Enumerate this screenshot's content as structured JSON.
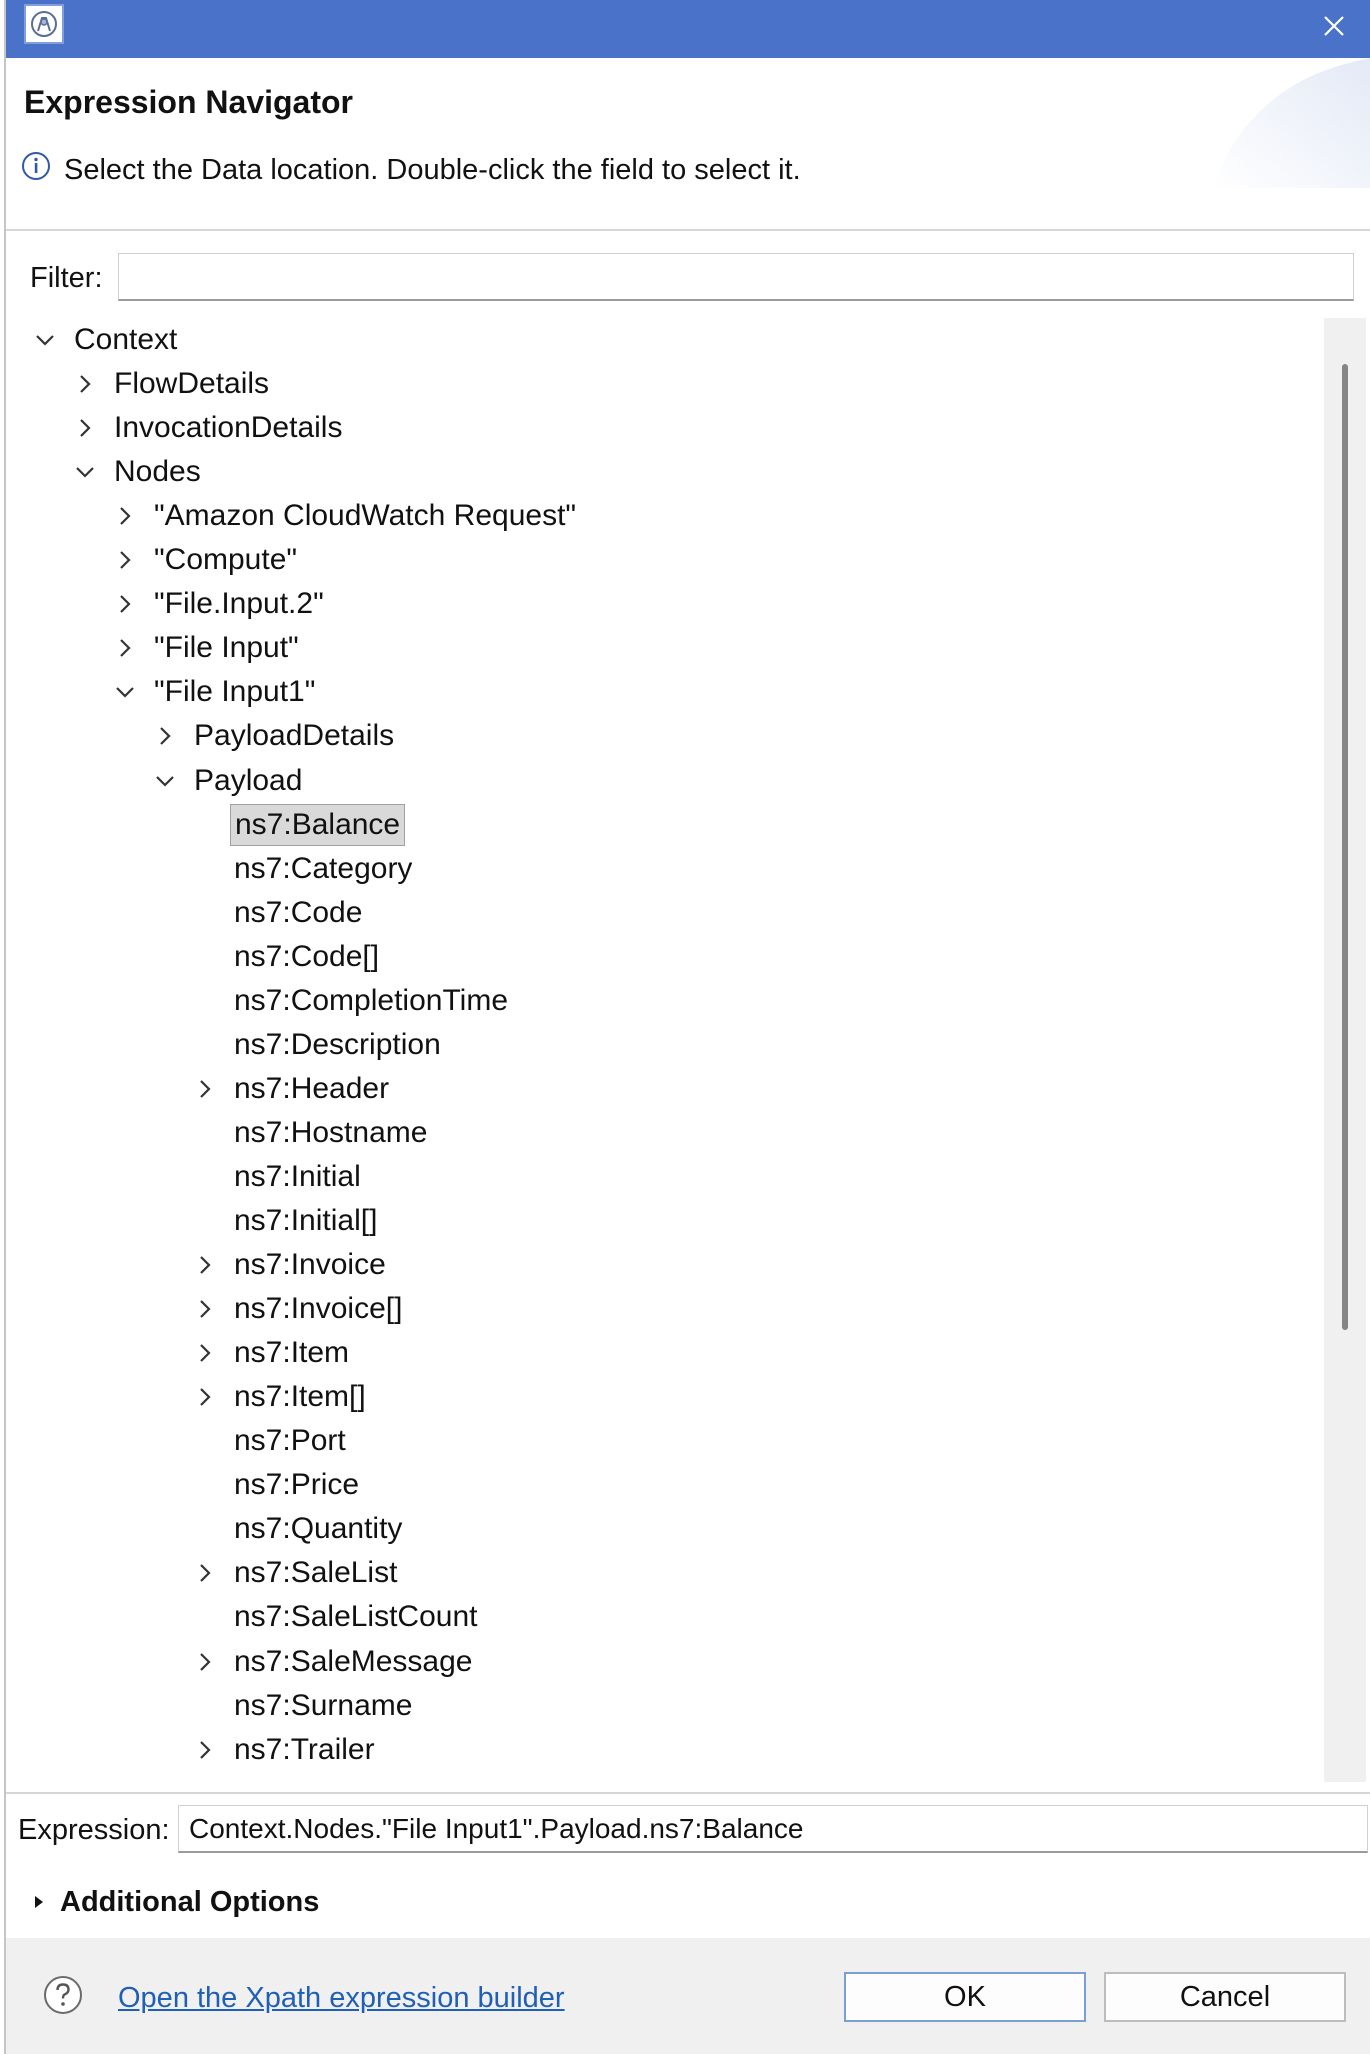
{
  "window": {
    "title": ""
  },
  "header": {
    "title": "Expression Navigator",
    "instruction": "Select the Data location. Double-click the field to select it."
  },
  "filter": {
    "label": "Filter:",
    "value": "",
    "placeholder": ""
  },
  "tree": {
    "items": [
      {
        "label": "Context",
        "level": 0,
        "expander": "expanded",
        "selected": false
      },
      {
        "label": "FlowDetails",
        "level": 1,
        "expander": "collapsed",
        "selected": false
      },
      {
        "label": "InvocationDetails",
        "level": 1,
        "expander": "collapsed",
        "selected": false
      },
      {
        "label": "Nodes",
        "level": 1,
        "expander": "expanded",
        "selected": false
      },
      {
        "label": "\"Amazon CloudWatch Request\"",
        "level": 2,
        "expander": "collapsed",
        "selected": false
      },
      {
        "label": "\"Compute\"",
        "level": 2,
        "expander": "collapsed",
        "selected": false
      },
      {
        "label": "\"File.Input.2\"",
        "level": 2,
        "expander": "collapsed",
        "selected": false
      },
      {
        "label": "\"File Input\"",
        "level": 2,
        "expander": "collapsed",
        "selected": false
      },
      {
        "label": "\"File Input1\"",
        "level": 2,
        "expander": "expanded",
        "selected": false
      },
      {
        "label": "PayloadDetails",
        "level": 3,
        "expander": "collapsed",
        "selected": false
      },
      {
        "label": "Payload",
        "level": 3,
        "expander": "expanded",
        "selected": false
      },
      {
        "label": "ns7:Balance",
        "level": 4,
        "expander": "none",
        "selected": true
      },
      {
        "label": "ns7:Category",
        "level": 4,
        "expander": "none",
        "selected": false
      },
      {
        "label": "ns7:Code",
        "level": 4,
        "expander": "none",
        "selected": false
      },
      {
        "label": "ns7:Code[]",
        "level": 4,
        "expander": "none",
        "selected": false
      },
      {
        "label": "ns7:CompletionTime",
        "level": 4,
        "expander": "none",
        "selected": false
      },
      {
        "label": "ns7:Description",
        "level": 4,
        "expander": "none",
        "selected": false
      },
      {
        "label": "ns7:Header",
        "level": 4,
        "expander": "collapsed",
        "selected": false
      },
      {
        "label": "ns7:Hostname",
        "level": 4,
        "expander": "none",
        "selected": false
      },
      {
        "label": "ns7:Initial",
        "level": 4,
        "expander": "none",
        "selected": false
      },
      {
        "label": "ns7:Initial[]",
        "level": 4,
        "expander": "none",
        "selected": false
      },
      {
        "label": "ns7:Invoice",
        "level": 4,
        "expander": "collapsed",
        "selected": false
      },
      {
        "label": "ns7:Invoice[]",
        "level": 4,
        "expander": "collapsed",
        "selected": false
      },
      {
        "label": "ns7:Item",
        "level": 4,
        "expander": "collapsed",
        "selected": false
      },
      {
        "label": "ns7:Item[]",
        "level": 4,
        "expander": "collapsed",
        "selected": false
      },
      {
        "label": "ns7:Port",
        "level": 4,
        "expander": "none",
        "selected": false
      },
      {
        "label": "ns7:Price",
        "level": 4,
        "expander": "none",
        "selected": false
      },
      {
        "label": "ns7:Quantity",
        "level": 4,
        "expander": "none",
        "selected": false
      },
      {
        "label": "ns7:SaleList",
        "level": 4,
        "expander": "collapsed",
        "selected": false
      },
      {
        "label": "ns7:SaleListCount",
        "level": 4,
        "expander": "none",
        "selected": false
      },
      {
        "label": "ns7:SaleMessage",
        "level": 4,
        "expander": "collapsed",
        "selected": false
      },
      {
        "label": "ns7:Surname",
        "level": 4,
        "expander": "none",
        "selected": false
      },
      {
        "label": "ns7:Trailer",
        "level": 4,
        "expander": "collapsed",
        "selected": false
      }
    ]
  },
  "expression": {
    "label": "Expression:",
    "value": "Context.Nodes.\"File Input1\".Payload.ns7:Balance"
  },
  "additional_options": {
    "label": "Additional Options",
    "expanded": false
  },
  "footer": {
    "link_label": "Open the Xpath expression builder",
    "ok_label": "OK",
    "cancel_label": "Cancel"
  },
  "icons": {
    "app": "app-logo-icon",
    "close": "close-icon",
    "info": "info-icon",
    "help": "help-icon",
    "expanded": "chevron-down-icon",
    "collapsed": "chevron-right-icon",
    "disclosure": "triangle-right-icon"
  },
  "colors": {
    "titlebar": "#4a72c9",
    "link": "#1f5fb6",
    "selection": "#d9d9d9",
    "footer": "#f0f0f0"
  }
}
